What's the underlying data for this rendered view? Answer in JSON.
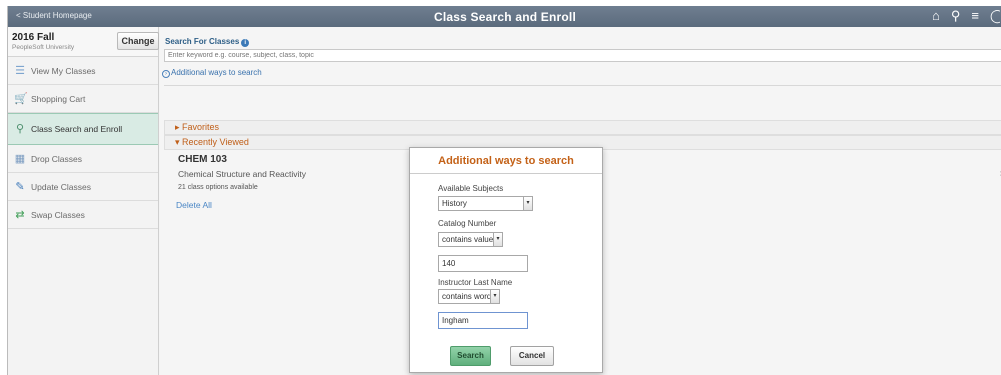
{
  "header": {
    "back_label": "< Student Homepage",
    "title": "Class Search and Enroll",
    "icons": [
      "home-icon",
      "search-icon",
      "menu-icon",
      "more-icon"
    ]
  },
  "term": {
    "name": "2016 Fall",
    "institution": "PeopleSoft University",
    "change_label": "Change"
  },
  "sidebar": {
    "items": [
      {
        "label": "View My Classes",
        "icon": "list-icon"
      },
      {
        "label": "Shopping Cart",
        "icon": "cart-icon"
      },
      {
        "label": "Class Search and Enroll",
        "icon": "search-icon",
        "active": true
      },
      {
        "label": "Drop Classes",
        "icon": "trash-icon"
      },
      {
        "label": "Update Classes",
        "icon": "edit-icon"
      },
      {
        "label": "Swap Classes",
        "icon": "swap-icon"
      }
    ]
  },
  "main": {
    "search_label": "Search For Classes",
    "search_placeholder": "Enter keyword e.g. course, subject, class, topic",
    "additional_link": "Additional ways to search",
    "favorites_label": "Favorites",
    "recently_viewed_label": "Recently Viewed",
    "recent": {
      "course": "CHEM 103",
      "title": "Chemical Structure and Reactivity",
      "options": "21 class options available"
    },
    "delete_all": "Delete All"
  },
  "modal": {
    "title": "Additional ways to search",
    "subjects_label": "Available Subjects",
    "subjects_value": "History",
    "catalog_label": "Catalog Number",
    "catalog_operator": "contains value",
    "catalog_value": "140",
    "instructor_label": "Instructor Last Name",
    "instructor_operator": "contains word",
    "instructor_value": "Ingham",
    "search_button": "Search",
    "cancel_button": "Cancel"
  },
  "colors": {
    "header_bg": "#5f6f82",
    "accent_orange": "#c46218",
    "link_blue": "#3a72ad",
    "active_nav_bg": "#d9ebe4",
    "search_button_green": "#60b07d"
  }
}
